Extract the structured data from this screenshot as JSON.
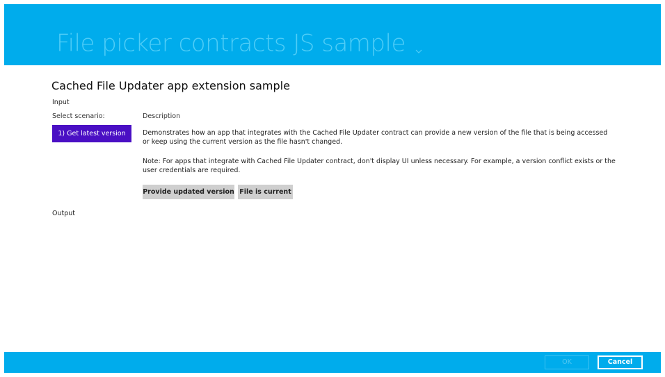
{
  "header": {
    "title": "File picker contracts JS sample",
    "chevron_icon": "chevron-down-icon"
  },
  "main": {
    "title": "Cached File Updater app extension sample",
    "input_label": "Input",
    "select_scenario_label": "Select scenario:",
    "scenario_button_label": "1) Get latest version",
    "description_label": "Description",
    "description_text": "Demonstrates how an app that integrates with the Cached File Updater contract can provide a new version of the file that is being accessed or keep using the current version as the file hasn't changed.",
    "note_text": "Note: For apps that integrate with Cached File Updater contract, don't display UI unless necessary. For example, a version conflict exists or the user credentials are required.",
    "provide_updated_button": "Provide updated version",
    "file_current_button": "File is current",
    "output_label": "Output"
  },
  "footer": {
    "ok_label": "OK",
    "cancel_label": "Cancel"
  },
  "colors": {
    "accent_blue": "#00acec",
    "title_blue": "#4fcdf7",
    "scenario_purple": "#4a0fc4",
    "button_gray": "#cfcfcf"
  }
}
